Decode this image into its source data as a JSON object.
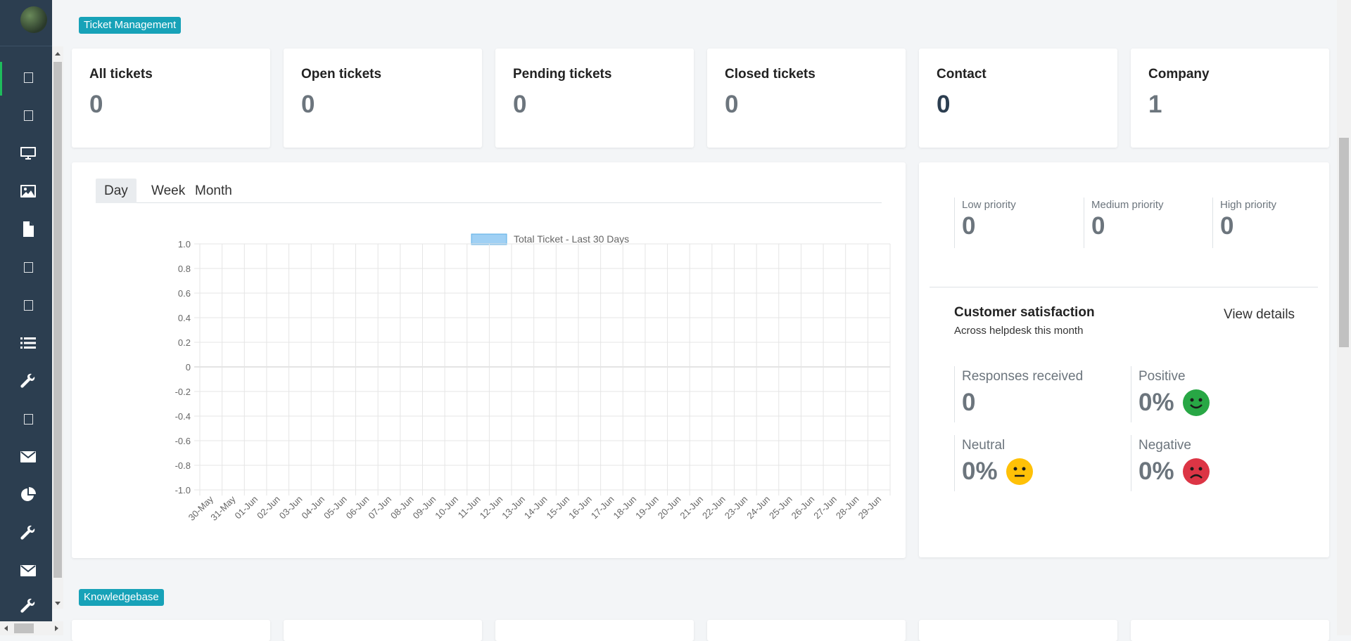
{
  "sections": {
    "ticket_management": "Ticket Management",
    "knowledgebase": "Knowledgebase"
  },
  "stats": [
    {
      "label": "All tickets",
      "value": "0"
    },
    {
      "label": "Open tickets",
      "value": "0"
    },
    {
      "label": "Pending tickets",
      "value": "0"
    },
    {
      "label": "Closed tickets",
      "value": "0"
    },
    {
      "label": "Contact",
      "value": "0"
    },
    {
      "label": "Company",
      "value": "1"
    }
  ],
  "tabs": [
    "Day",
    "Week",
    "Month"
  ],
  "active_tab": "Day",
  "priority": [
    {
      "label": "Low priority",
      "value": "0"
    },
    {
      "label": "Medium priority",
      "value": "0"
    },
    {
      "label": "High priority",
      "value": "0"
    }
  ],
  "satisfaction": {
    "title": "Customer satisfaction",
    "subtitle": "Across helpdesk this month",
    "view_details": "View details",
    "responses_label": "Responses received",
    "responses_value": "0",
    "positive_label": "Positive",
    "positive_value": "0%",
    "neutral_label": "Neutral",
    "neutral_value": "0%",
    "negative_label": "Negative",
    "negative_value": "0%"
  },
  "colors": {
    "sidebar": "#2c3e50",
    "tag": "#17a2b8",
    "positive": "#28a745",
    "neutral": "#ffc107",
    "negative": "#dc3545",
    "series_fill": "#9fd0f4",
    "series_border": "#5aaee6"
  },
  "sidebar_icons": [
    "square-icon",
    "square-icon",
    "desktop-icon",
    "image-icon",
    "file-icon",
    "square-icon",
    "square-icon",
    "list-icon",
    "wrench-icon",
    "square-icon",
    "envelope-icon",
    "pie-chart-icon",
    "wrench-icon",
    "envelope-icon",
    "wrench-icon"
  ],
  "chart_data": {
    "type": "bar",
    "legend": "Total Ticket - Last 30 Days",
    "legend_position": "top",
    "categories": [
      "30-May",
      "31-May",
      "01-Jun",
      "02-Jun",
      "03-Jun",
      "04-Jun",
      "05-Jun",
      "06-Jun",
      "07-Jun",
      "08-Jun",
      "09-Jun",
      "10-Jun",
      "11-Jun",
      "12-Jun",
      "13-Jun",
      "14-Jun",
      "15-Jun",
      "16-Jun",
      "17-Jun",
      "18-Jun",
      "19-Jun",
      "20-Jun",
      "21-Jun",
      "22-Jun",
      "23-Jun",
      "24-Jun",
      "25-Jun",
      "26-Jun",
      "27-Jun",
      "28-Jun",
      "29-Jun"
    ],
    "series": [
      {
        "name": "Total Ticket - Last 30 Days",
        "values": [
          0,
          0,
          0,
          0,
          0,
          0,
          0,
          0,
          0,
          0,
          0,
          0,
          0,
          0,
          0,
          0,
          0,
          0,
          0,
          0,
          0,
          0,
          0,
          0,
          0,
          0,
          0,
          0,
          0,
          0,
          0
        ]
      }
    ],
    "ylim": [
      -1.0,
      1.0
    ],
    "yticks": [
      "1.0",
      "0.8",
      "0.6",
      "0.4",
      "0.2",
      "0",
      "-0.2",
      "-0.4",
      "-0.6",
      "-0.8",
      "-1.0"
    ],
    "grid": true
  }
}
